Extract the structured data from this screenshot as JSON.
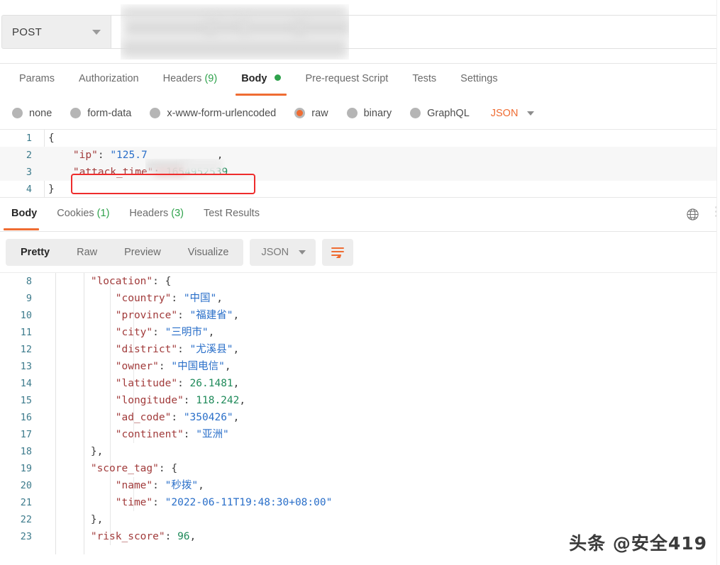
{
  "request": {
    "method": "POST",
    "url_redacted": true,
    "tabs": [
      {
        "label": "Params",
        "count": null,
        "active": false
      },
      {
        "label": "Authorization",
        "count": null,
        "active": false
      },
      {
        "label": "Headers",
        "count": "(9)",
        "active": false
      },
      {
        "label": "Body",
        "count": null,
        "active": true,
        "dot": true
      },
      {
        "label": "Pre-request Script",
        "count": null,
        "active": false
      },
      {
        "label": "Tests",
        "count": null,
        "active": false
      },
      {
        "label": "Settings",
        "count": null,
        "active": false
      }
    ],
    "body_types": [
      {
        "label": "none",
        "selected": false
      },
      {
        "label": "form-data",
        "selected": false
      },
      {
        "label": "x-www-form-urlencoded",
        "selected": false
      },
      {
        "label": "raw",
        "selected": true
      },
      {
        "label": "binary",
        "selected": false
      },
      {
        "label": "GraphQL",
        "selected": false
      }
    ],
    "format": "JSON",
    "editor": {
      "lines": [
        {
          "num": "1",
          "open_brace": "{"
        },
        {
          "num": "2",
          "key": "\"ip\"",
          "colon": ": ",
          "value_prefix": "\"125.7",
          "trailing": ","
        },
        {
          "num": "3",
          "key": "\"attack_time\"",
          "colon": ": ",
          "number": "1654952539",
          "highlighted": true
        },
        {
          "num": "4",
          "close_brace": "}"
        }
      ]
    }
  },
  "response": {
    "tabs": [
      {
        "label": "Body",
        "count": null,
        "active": true
      },
      {
        "label": "Cookies",
        "count": "(1)",
        "active": false
      },
      {
        "label": "Headers",
        "count": "(3)",
        "active": false
      },
      {
        "label": "Test Results",
        "count": null,
        "active": false
      }
    ],
    "view_modes": [
      {
        "label": "Pretty",
        "active": true
      },
      {
        "label": "Raw",
        "active": false
      },
      {
        "label": "Preview",
        "active": false
      },
      {
        "label": "Visualize",
        "active": false
      }
    ],
    "format": "JSON",
    "icons": {
      "globe": "globe-icon",
      "wrap": "wrap-lines-icon",
      "more": "more-options-icon"
    },
    "json_lines": [
      {
        "num": "8",
        "indent": 2,
        "key": "\"location\"",
        "colon": ": ",
        "brace": "{"
      },
      {
        "num": "9",
        "indent": 3,
        "key": "\"country\"",
        "colon": ": ",
        "string": "\"中国\"",
        "comma": ","
      },
      {
        "num": "10",
        "indent": 3,
        "key": "\"province\"",
        "colon": ": ",
        "string": "\"福建省\"",
        "comma": ","
      },
      {
        "num": "11",
        "indent": 3,
        "key": "\"city\"",
        "colon": ": ",
        "string": "\"三明市\"",
        "comma": ","
      },
      {
        "num": "12",
        "indent": 3,
        "key": "\"district\"",
        "colon": ": ",
        "string": "\"尤溪县\"",
        "comma": ","
      },
      {
        "num": "13",
        "indent": 3,
        "key": "\"owner\"",
        "colon": ": ",
        "string": "\"中国电信\"",
        "comma": ","
      },
      {
        "num": "14",
        "indent": 3,
        "key": "\"latitude\"",
        "colon": ": ",
        "number": "26.1481",
        "comma": ","
      },
      {
        "num": "15",
        "indent": 3,
        "key": "\"longitude\"",
        "colon": ": ",
        "number": "118.242",
        "comma": ","
      },
      {
        "num": "16",
        "indent": 3,
        "key": "\"ad_code\"",
        "colon": ": ",
        "string": "\"350426\"",
        "comma": ","
      },
      {
        "num": "17",
        "indent": 3,
        "key": "\"continent\"",
        "colon": ": ",
        "string": "\"亚洲\""
      },
      {
        "num": "18",
        "indent": 2,
        "brace": "},"
      },
      {
        "num": "19",
        "indent": 2,
        "key": "\"score_tag\"",
        "colon": ": ",
        "brace": "{"
      },
      {
        "num": "20",
        "indent": 3,
        "key": "\"name\"",
        "colon": ": ",
        "string": "\"秒拨\"",
        "comma": ","
      },
      {
        "num": "21",
        "indent": 3,
        "key": "\"time\"",
        "colon": ": ",
        "string": "\"2022-06-11T19:48:30+08:00\""
      },
      {
        "num": "22",
        "indent": 2,
        "brace": "},"
      },
      {
        "num": "23",
        "indent": 2,
        "key": "\"risk_score\"",
        "colon": ": ",
        "number": "96",
        "comma": ","
      }
    ]
  },
  "watermark": "头条 @安全419",
  "colors": {
    "accent_orange": "#ef6c32",
    "green": "#2fa24c",
    "json_key": "#a13b3b",
    "json_string": "#2a6fc9",
    "json_number": "#1f8a5a",
    "line_number": "#3d7b8c",
    "highlight_box": "#ee2c2c"
  }
}
